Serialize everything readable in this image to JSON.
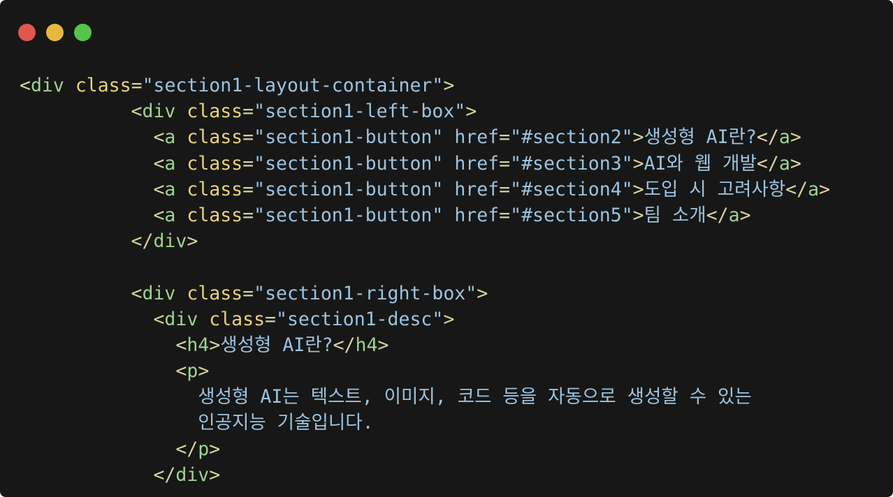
{
  "window": {
    "controls": [
      {
        "name": "close",
        "color": "#e0574e"
      },
      {
        "name": "minimize",
        "color": "#e8b73e"
      },
      {
        "name": "maximize",
        "color": "#58c34a"
      }
    ],
    "background": "#171717"
  },
  "colors": {
    "punct": "#d6d3a0",
    "tag": "#9fd38c",
    "attr": "#e8d27a",
    "string": "#9cc3e0",
    "text": "#9cc3e0"
  },
  "code_lines": [
    [
      {
        "t": "punct",
        "v": "<"
      },
      {
        "t": "tag",
        "v": "div"
      },
      {
        "t": "text",
        "v": " "
      },
      {
        "t": "attr",
        "v": "class"
      },
      {
        "t": "punct",
        "v": "="
      },
      {
        "t": "str",
        "v": "\"section1-layout-container\""
      },
      {
        "t": "punct",
        "v": ">"
      }
    ],
    [
      {
        "t": "text",
        "v": "          "
      },
      {
        "t": "punct",
        "v": "<"
      },
      {
        "t": "tag",
        "v": "div"
      },
      {
        "t": "text",
        "v": " "
      },
      {
        "t": "attr",
        "v": "class"
      },
      {
        "t": "punct",
        "v": "="
      },
      {
        "t": "str",
        "v": "\"section1-left-box\""
      },
      {
        "t": "punct",
        "v": ">"
      }
    ],
    [
      {
        "t": "text",
        "v": "            "
      },
      {
        "t": "punct",
        "v": "<"
      },
      {
        "t": "tag",
        "v": "a"
      },
      {
        "t": "text",
        "v": " "
      },
      {
        "t": "attr",
        "v": "class"
      },
      {
        "t": "punct",
        "v": "="
      },
      {
        "t": "str",
        "v": "\"section1-button\""
      },
      {
        "t": "text",
        "v": " "
      },
      {
        "t": "str",
        "v": "href"
      },
      {
        "t": "punct",
        "v": "="
      },
      {
        "t": "str",
        "v": "\"#section2\""
      },
      {
        "t": "punct",
        "v": ">"
      },
      {
        "t": "text",
        "v": "생성형 AI란?"
      },
      {
        "t": "punct",
        "v": "</"
      },
      {
        "t": "tag",
        "v": "a"
      },
      {
        "t": "punct",
        "v": ">"
      }
    ],
    [
      {
        "t": "text",
        "v": "            "
      },
      {
        "t": "punct",
        "v": "<"
      },
      {
        "t": "tag",
        "v": "a"
      },
      {
        "t": "text",
        "v": " "
      },
      {
        "t": "attr",
        "v": "class"
      },
      {
        "t": "punct",
        "v": "="
      },
      {
        "t": "str",
        "v": "\"section1-button\""
      },
      {
        "t": "text",
        "v": " "
      },
      {
        "t": "str",
        "v": "href"
      },
      {
        "t": "punct",
        "v": "="
      },
      {
        "t": "str",
        "v": "\"#section3\""
      },
      {
        "t": "punct",
        "v": ">"
      },
      {
        "t": "text",
        "v": "AI와 웹 개발"
      },
      {
        "t": "punct",
        "v": "</"
      },
      {
        "t": "tag",
        "v": "a"
      },
      {
        "t": "punct",
        "v": ">"
      }
    ],
    [
      {
        "t": "text",
        "v": "            "
      },
      {
        "t": "punct",
        "v": "<"
      },
      {
        "t": "tag",
        "v": "a"
      },
      {
        "t": "text",
        "v": " "
      },
      {
        "t": "attr",
        "v": "class"
      },
      {
        "t": "punct",
        "v": "="
      },
      {
        "t": "str",
        "v": "\"section1-button\""
      },
      {
        "t": "text",
        "v": " "
      },
      {
        "t": "str",
        "v": "href"
      },
      {
        "t": "punct",
        "v": "="
      },
      {
        "t": "str",
        "v": "\"#section4\""
      },
      {
        "t": "punct",
        "v": ">"
      },
      {
        "t": "text",
        "v": "도입 시 고려사항"
      },
      {
        "t": "punct",
        "v": "</"
      },
      {
        "t": "tag",
        "v": "a"
      },
      {
        "t": "punct",
        "v": ">"
      }
    ],
    [
      {
        "t": "text",
        "v": "            "
      },
      {
        "t": "punct",
        "v": "<"
      },
      {
        "t": "tag",
        "v": "a"
      },
      {
        "t": "text",
        "v": " "
      },
      {
        "t": "attr",
        "v": "class"
      },
      {
        "t": "punct",
        "v": "="
      },
      {
        "t": "str",
        "v": "\"section1-button\""
      },
      {
        "t": "text",
        "v": " "
      },
      {
        "t": "str",
        "v": "href"
      },
      {
        "t": "punct",
        "v": "="
      },
      {
        "t": "str",
        "v": "\"#section5\""
      },
      {
        "t": "punct",
        "v": ">"
      },
      {
        "t": "text",
        "v": "팀 소개"
      },
      {
        "t": "punct",
        "v": "</"
      },
      {
        "t": "tag",
        "v": "a"
      },
      {
        "t": "punct",
        "v": ">"
      }
    ],
    [
      {
        "t": "text",
        "v": "          "
      },
      {
        "t": "punct",
        "v": "</"
      },
      {
        "t": "tag",
        "v": "div"
      },
      {
        "t": "punct",
        "v": ">"
      }
    ],
    [],
    [
      {
        "t": "text",
        "v": "          "
      },
      {
        "t": "punct",
        "v": "<"
      },
      {
        "t": "tag",
        "v": "div"
      },
      {
        "t": "text",
        "v": " "
      },
      {
        "t": "attr",
        "v": "class"
      },
      {
        "t": "punct",
        "v": "="
      },
      {
        "t": "str",
        "v": "\"section1-right-box\""
      },
      {
        "t": "punct",
        "v": ">"
      }
    ],
    [
      {
        "t": "text",
        "v": "            "
      },
      {
        "t": "punct",
        "v": "<"
      },
      {
        "t": "tag",
        "v": "div"
      },
      {
        "t": "text",
        "v": " "
      },
      {
        "t": "attr",
        "v": "class"
      },
      {
        "t": "punct",
        "v": "="
      },
      {
        "t": "str",
        "v": "\"section1-desc\""
      },
      {
        "t": "punct",
        "v": ">"
      }
    ],
    [
      {
        "t": "text",
        "v": "              "
      },
      {
        "t": "punct",
        "v": "<"
      },
      {
        "t": "tag",
        "v": "h4"
      },
      {
        "t": "punct",
        "v": ">"
      },
      {
        "t": "text",
        "v": "생성형 AI란?"
      },
      {
        "t": "punct",
        "v": "</"
      },
      {
        "t": "tag",
        "v": "h4"
      },
      {
        "t": "punct",
        "v": ">"
      }
    ],
    [
      {
        "t": "text",
        "v": "              "
      },
      {
        "t": "punct",
        "v": "<"
      },
      {
        "t": "tag",
        "v": "p"
      },
      {
        "t": "punct",
        "v": ">"
      }
    ],
    [
      {
        "t": "text",
        "v": "                "
      },
      {
        "t": "text",
        "v": "생성형 AI는 텍스트, 이미지, 코드 등을 자동으로 생성할 수 있는"
      }
    ],
    [
      {
        "t": "text",
        "v": "                "
      },
      {
        "t": "text",
        "v": "인공지능 기술입니다."
      }
    ],
    [
      {
        "t": "text",
        "v": "              "
      },
      {
        "t": "punct",
        "v": "</"
      },
      {
        "t": "tag",
        "v": "p"
      },
      {
        "t": "punct",
        "v": ">"
      }
    ],
    [
      {
        "t": "text",
        "v": "            "
      },
      {
        "t": "punct",
        "v": "</"
      },
      {
        "t": "tag",
        "v": "div"
      },
      {
        "t": "punct",
        "v": ">"
      }
    ]
  ]
}
